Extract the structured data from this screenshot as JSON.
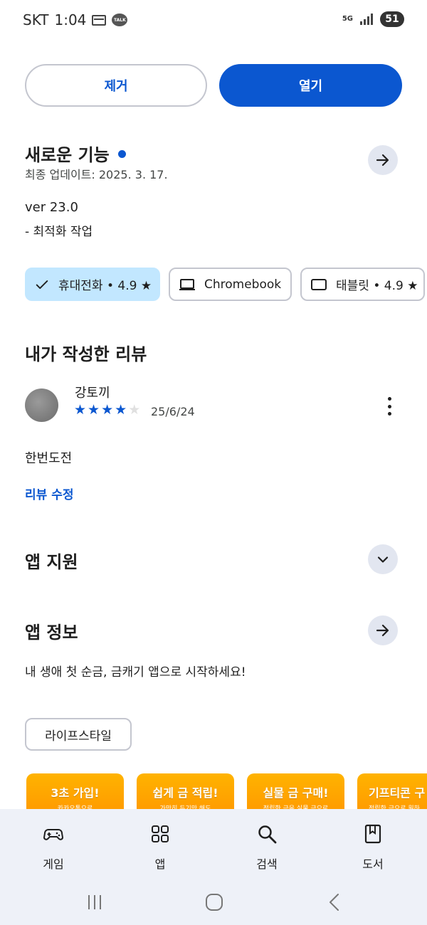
{
  "status_bar": {
    "carrier": "SKT",
    "time": "1:04",
    "talk_badge": "TALK",
    "network": "5G",
    "battery": "51"
  },
  "actions": {
    "remove_label": "제거",
    "open_label": "열기"
  },
  "whats_new": {
    "title": "새로운 기능",
    "updated": "최종 업데이트: 2025. 3. 17.",
    "version": "ver 23.0",
    "notes": "- 최적화 작업"
  },
  "device_chips": [
    {
      "label": "휴대전화 • 4.9 ★",
      "selected": true,
      "icon": "check-icon"
    },
    {
      "label": "Chromebook",
      "selected": false,
      "icon": "laptop-icon"
    },
    {
      "label": "태블릿 • 4.9 ★",
      "selected": false,
      "icon": "tablet-icon"
    }
  ],
  "my_review": {
    "title": "내가 작성한 리뷰",
    "author": "강토끼",
    "rating": 4,
    "max_rating": 5,
    "date": "25/6/24",
    "text": "한번도전",
    "edit_label": "리뷰 수정"
  },
  "app_support": {
    "title": "앱 지원"
  },
  "app_info": {
    "title": "앱 정보",
    "description": "내 생애 첫 순금, 금캐기 앱으로 시작하세요!",
    "category": "라이프스타일"
  },
  "screenshots": [
    {
      "headline": "3초 가입!",
      "sub": "카카오톡으로"
    },
    {
      "headline": "쉽게 금 적립!",
      "sub": "가만히 두기만 해도"
    },
    {
      "headline": "실물 금 구매!",
      "sub": "적립한 금을 실물 금으로"
    },
    {
      "headline": "기프티콘 구",
      "sub": "적립한 금으로 원하"
    }
  ],
  "bottom_nav": [
    {
      "label": "게임",
      "icon": "gamepad-icon"
    },
    {
      "label": "앱",
      "icon": "apps-grid-icon"
    },
    {
      "label": "검색",
      "icon": "search-icon"
    },
    {
      "label": "도서",
      "icon": "book-icon"
    }
  ],
  "colors": {
    "accent": "#0b57d0",
    "selected_chip": "#c2e7ff",
    "circle_button": "#e2e6f0",
    "nav_background": "#eef1f8",
    "screenshot_orange": "#ffa000"
  }
}
